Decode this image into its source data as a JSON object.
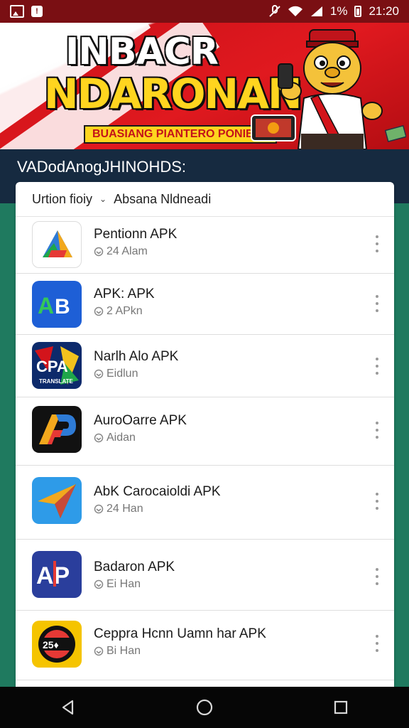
{
  "status_bar": {
    "battery_text": "1%",
    "time": "21:20",
    "icons": [
      "image-icon",
      "notification-icon",
      "mute-icon",
      "wifi-icon",
      "signal-icon",
      "battery-icon"
    ]
  },
  "banner": {
    "title_line1": "INBACR",
    "title_line2": "NDARONAN",
    "subtitle": "BUASIANG PIANTERO PONIBIRI"
  },
  "section": {
    "title": "VADodAnogJHINOHDS:"
  },
  "filter": {
    "left_label": "Urtion fioiy",
    "right_label": "Absana Nldneadi"
  },
  "apps": [
    {
      "name": "Pentionn APK",
      "meta": "24 Alam",
      "icon": "triangle-a-icon",
      "accent": "#e53935"
    },
    {
      "name": "APK: APK",
      "meta": "2 APkn",
      "icon": "ab-icon",
      "accent": "#1e5fd6"
    },
    {
      "name": "Narlh Alo APK",
      "meta": "Eidlun",
      "icon": "cpa-icon",
      "accent": "#0d2a6b"
    },
    {
      "name": "AuroOarre APK",
      "meta": "Aidan",
      "icon": "ap-dark-icon",
      "accent": "#111111"
    },
    {
      "name": "AbK Carocaioldi APK",
      "meta": "24 Han",
      "icon": "paper-plane-icon",
      "accent": "#2e9be8"
    },
    {
      "name": "Badaron APK",
      "meta": "Ei Han",
      "icon": "ap-blue-icon",
      "accent": "#2a3e9c"
    },
    {
      "name": "Ceppra Hcnn Uamn har APK",
      "meta": "Bi Han",
      "icon": "badge-icon",
      "accent": "#f5c400"
    }
  ],
  "nav": {
    "buttons": [
      "back-nav",
      "home-nav",
      "recents-nav"
    ]
  }
}
